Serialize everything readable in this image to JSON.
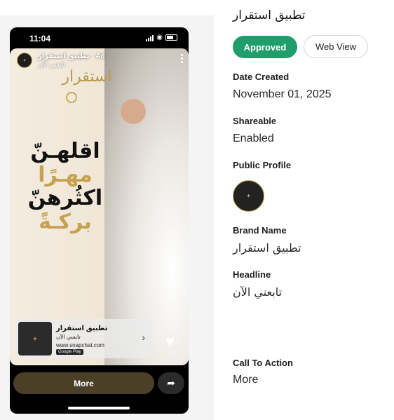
{
  "app_title": "تطبيق استقرار",
  "status": "Approved",
  "web_view_label": "Web View",
  "fields": {
    "date_created": {
      "label": "Date Created",
      "value": "November 01, 2025"
    },
    "shareable": {
      "label": "Shareable",
      "value": "Enabled"
    },
    "public_profile": {
      "label": "Public Profile"
    },
    "brand_name": {
      "label": "Brand Name",
      "value": "تطبيق استقرار"
    },
    "headline": {
      "label": "Headline",
      "value": "تابعني الآن"
    },
    "call_to_action": {
      "label": "Call To Action",
      "value": "More"
    }
  },
  "preview": {
    "time": "11:04",
    "ad_name": "تطبيق استقرار · Ad",
    "ad_subline": "تابعني الآن",
    "logo_text": "استقرار",
    "creative_lines": [
      "اقلهـنّ",
      "مهـرًا",
      "اكثُرهنّ",
      "بركـةً"
    ],
    "app_card": {
      "title": "تطبيق استقرار",
      "subtitle": "تابعني الآن",
      "url": "www.snapchat.com",
      "store": "Google Play"
    },
    "more_label": "More"
  },
  "colors": {
    "approved_green": "#1f9d6a",
    "brand_gold": "#c6a150",
    "more_button_bg": "#4b3f27"
  },
  "icons": [
    "signal-icon",
    "wifi-icon",
    "battery-icon",
    "kebab-menu-icon",
    "chevron-right-icon",
    "heart-icon",
    "share-arrow-icon"
  ]
}
